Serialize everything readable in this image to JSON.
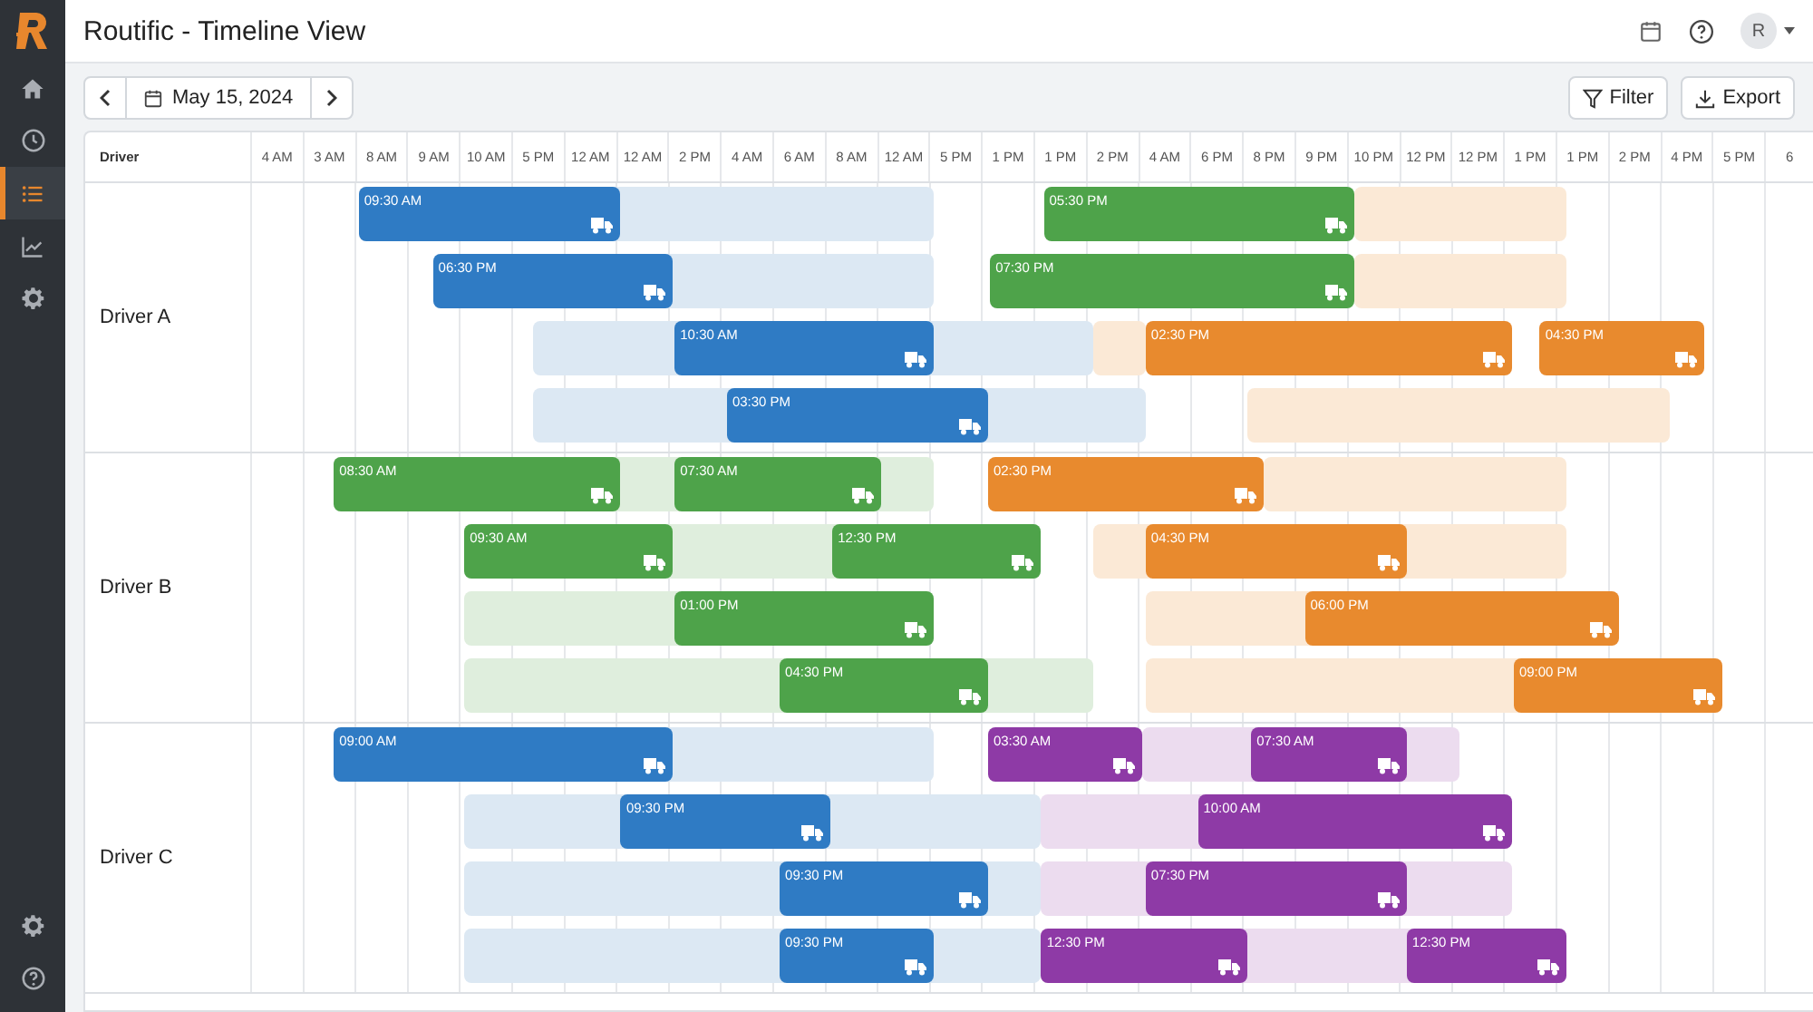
{
  "app": {
    "title": "Routific - Timeline View"
  },
  "sidebar": {
    "items": [
      {
        "selected": false
      },
      {
        "selected": false
      },
      {
        "selected": true
      },
      {
        "selected": false
      },
      {
        "selected": false
      }
    ],
    "bottom_items": [
      {
        "selected": false
      },
      {
        "selected": false
      }
    ]
  },
  "topbar": {
    "avatar": "R"
  },
  "toolbar": {
    "date": "May 15, 2024",
    "buttons": [
      "Filter",
      "Export"
    ]
  },
  "timeline": {
    "driver_header": "Driver",
    "columns": [
      "4 AM",
      "3 AM",
      "8 AM",
      "9 AM",
      "10 AM",
      "5 PM",
      "12 AM",
      "12 AM",
      "2 PM",
      "4 AM",
      "6 AM",
      "8 AM",
      "12 AM",
      "5 PM",
      "1 PM",
      "1 PM",
      "2 PM",
      "4 AM",
      "6 PM",
      "8 PM",
      "9 PM",
      "10 PM",
      "12 PM",
      "12 PM",
      "1 PM",
      "1 PM",
      "2 PM",
      "4 PM",
      "5 PM",
      "6"
    ],
    "drivers": [
      {
        "name": "Driver A",
        "lanes": [
          {
            "segments": [
              {
                "kind": "slot",
                "color": "#dce8f3"
              },
              {
                "kind": "trip",
                "color": "#2f7bc4",
                "time": "09:30 AM"
              },
              {
                "kind": "trip",
                "color": "#4ea34a",
                "time": "05:30 PM"
              },
              {
                "kind": "slot",
                "color": "#fbe9d6"
              }
            ]
          },
          {
            "segments": [
              {
                "kind": "slot",
                "color": "#dce8f3"
              },
              {
                "kind": "trip",
                "color": "#2f7bc4",
                "time": "06:30 PM"
              },
              {
                "kind": "trip",
                "color": "#4ea34a",
                "time": "07:30 PM"
              },
              {
                "kind": "slot",
                "color": "#fbe9d6"
              }
            ]
          },
          {
            "segments": [
              {
                "kind": "slot",
                "color": "#dce8f3"
              },
              {
                "kind": "slot",
                "color": "#fbe9d6"
              },
              {
                "kind": "trip",
                "color": "#2f7bc4",
                "time": "10:30 AM"
              },
              {
                "kind": "trip",
                "color": "#e88a2e",
                "time": "02:30 PM"
              },
              {
                "kind": "trip",
                "color": "#e88a2e",
                "time": "04:30 PM"
              }
            ]
          },
          {
            "segments": [
              {
                "kind": "slot",
                "color": "#dce8f3"
              },
              {
                "kind": "trip",
                "color": "#2f7bc4",
                "time": "03:30 PM"
              },
              {
                "kind": "slot",
                "color": "#fbe9d6"
              }
            ]
          }
        ]
      },
      {
        "name": "Driver B",
        "lanes": [
          {
            "segments": [
              {
                "kind": "slot",
                "color": "#dfeedd"
              },
              {
                "kind": "trip",
                "color": "#4ea34a",
                "time": "08:30 AM"
              },
              {
                "kind": "trip",
                "color": "#4ea34a",
                "time": "07:30 AM"
              },
              {
                "kind": "trip",
                "color": "#e88a2e",
                "time": "02:30 PM"
              },
              {
                "kind": "slot",
                "color": "#fbe9d6"
              }
            ]
          },
          {
            "segments": [
              {
                "kind": "slot",
                "color": "#dfeedd"
              },
              {
                "kind": "trip",
                "color": "#4ea34a",
                "time": "09:30 AM"
              },
              {
                "kind": "trip",
                "color": "#4ea34a",
                "time": "12:30 PM"
              },
              {
                "kind": "slot",
                "color": "#fbe9d6"
              },
              {
                "kind": "trip",
                "color": "#e88a2e",
                "time": "04:30 PM"
              }
            ]
          },
          {
            "segments": [
              {
                "kind": "slot",
                "color": "#dfeedd"
              },
              {
                "kind": "trip",
                "color": "#4ea34a",
                "time": "01:00 PM"
              },
              {
                "kind": "slot",
                "color": "#fbe9d6"
              },
              {
                "kind": "trip",
                "color": "#e88a2e",
                "time": "06:00 PM"
              }
            ]
          },
          {
            "segments": [
              {
                "kind": "slot",
                "color": "#dfeedd"
              },
              {
                "kind": "trip",
                "color": "#4ea34a",
                "time": "04:30 PM"
              },
              {
                "kind": "slot",
                "color": "#fbe9d6"
              },
              {
                "kind": "trip",
                "color": "#e88a2e",
                "time": "09:00 PM"
              }
            ]
          }
        ]
      },
      {
        "name": "Driver C",
        "lanes": [
          {
            "segments": [
              {
                "kind": "slot",
                "color": "#dce8f3"
              },
              {
                "kind": "trip",
                "color": "#2f7bc4",
                "time": "09:00 AM"
              },
              {
                "kind": "trip",
                "color": "#8e3aa6",
                "time": "03:30 AM"
              },
              {
                "kind": "slot",
                "color": "#ecdcef"
              },
              {
                "kind": "trip",
                "color": "#8e3aa6",
                "time": "07:30 AM"
              }
            ]
          },
          {
            "segments": [
              {
                "kind": "slot",
                "color": "#dce8f3"
              },
              {
                "kind": "trip",
                "color": "#2f7bc4",
                "time": "09:30 PM"
              },
              {
                "kind": "slot",
                "color": "#ecdcef"
              },
              {
                "kind": "trip",
                "color": "#8e3aa6",
                "time": "10:00 AM"
              }
            ]
          },
          {
            "segments": [
              {
                "kind": "slot",
                "color": "#dce8f3"
              },
              {
                "kind": "trip",
                "color": "#2f7bc4",
                "time": "09:30 PM"
              },
              {
                "kind": "slot",
                "color": "#ecdcef"
              },
              {
                "kind": "trip",
                "color": "#8e3aa6",
                "time": "07:30 PM"
              }
            ]
          },
          {
            "segments": [
              {
                "kind": "slot",
                "color": "#dce8f3"
              },
              {
                "kind": "trip",
                "color": "#2f7bc4",
                "time": "09:30 PM"
              },
              {
                "kind": "slot",
                "color": "#ecdcef"
              },
              {
                "kind": "trip",
                "color": "#8e3aa6",
                "time": "12:30 PM"
              },
              {
                "kind": "trip",
                "color": "#8e3aa6",
                "time": "12:30 PM"
              }
            ]
          }
        ]
      }
    ]
  }
}
